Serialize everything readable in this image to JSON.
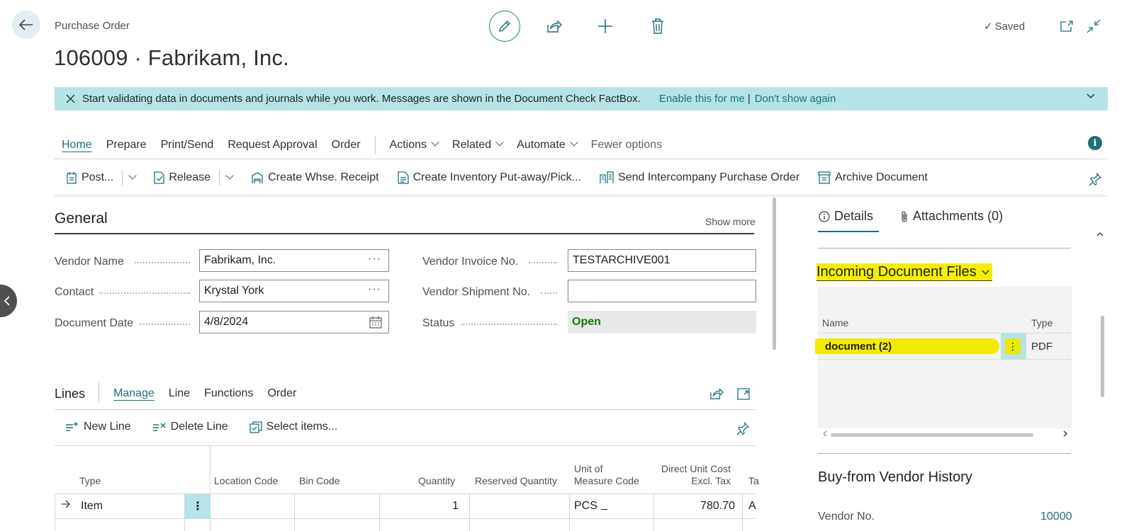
{
  "header": {
    "caption": "Purchase Order",
    "title": "106009 · Fabrikam, Inc.",
    "status": "Saved",
    "icons": [
      "back-arrow-icon",
      "pencil-icon",
      "share-icon",
      "plus-icon",
      "trash-icon",
      "open-new-window-icon",
      "collapse-icon"
    ]
  },
  "banner": {
    "message": "Start validating data in documents and journals while you work. Messages are shown in the Document Check FactBox.",
    "enable_link": "Enable this for me",
    "separator": "|",
    "dismiss_link": "Don't show again"
  },
  "menu": {
    "items": [
      "Home",
      "Prepare",
      "Print/Send",
      "Request Approval",
      "Order"
    ],
    "dropdowns": [
      "Actions",
      "Related",
      "Automate"
    ],
    "fewer": "Fewer options",
    "active": "Home"
  },
  "toolbar": {
    "post": "Post...",
    "release": "Release",
    "create_whse_receipt": "Create Whse. Receipt",
    "create_inventory": "Create Inventory Put-away/Pick...",
    "send_intercompany": "Send Intercompany Purchase Order",
    "archive": "Archive Document"
  },
  "general": {
    "title": "General",
    "show_more": "Show more",
    "vendor_name_label": "Vendor Name",
    "vendor_name_value": "Fabrikam, Inc.",
    "contact_label": "Contact",
    "contact_value": "Krystal York",
    "document_date_label": "Document Date",
    "document_date_value": "4/8/2024",
    "vendor_invoice_label": "Vendor Invoice No.",
    "vendor_invoice_value": "TESTARCHIVE001",
    "vendor_shipment_label": "Vendor Shipment No.",
    "vendor_shipment_value": "",
    "status_label": "Status",
    "status_value": "Open",
    "ellipsis": "···"
  },
  "lines": {
    "title": "Lines",
    "tabs": [
      "Manage",
      "Line",
      "Functions",
      "Order"
    ],
    "active_tab": "Manage",
    "new_line": "New Line",
    "delete_line": "Delete Line",
    "select_items": "Select items...",
    "columns": {
      "type": "Type",
      "location": "Location Code",
      "bin": "Bin Code",
      "quantity": "Quantity",
      "reserved": "Reserved Quantity",
      "uom_1": "Unit of",
      "uom_2": "Measure Code",
      "cost_1": "Direct Unit Cost",
      "cost_2": "Excl. Tax",
      "tax": "Ta"
    },
    "rows": [
      {
        "type": "Item",
        "location": "",
        "bin": "",
        "quantity": "1",
        "reserved": "_",
        "uom": "PCS",
        "cost": "780.70",
        "tax": "A"
      }
    ],
    "row_kebab": "⋮"
  },
  "factbox": {
    "tabs": [
      "Details",
      "Attachments (0)"
    ],
    "active_tab": "Details",
    "incoming": {
      "title": "Incoming Document Files",
      "col_name": "Name",
      "col_type": "Type",
      "rows": [
        {
          "name": "document (2)",
          "type": "PDF"
        }
      ],
      "kebab": "⋮"
    },
    "history": {
      "title": "Buy-from Vendor History",
      "vendor_no_label": "Vendor No.",
      "vendor_no_value": "10000"
    }
  },
  "colors": {
    "accent": "#1f6f78",
    "banner_bg": "#b6e3e6",
    "highlight": "#f6ee00",
    "status_open": "#107c10"
  }
}
